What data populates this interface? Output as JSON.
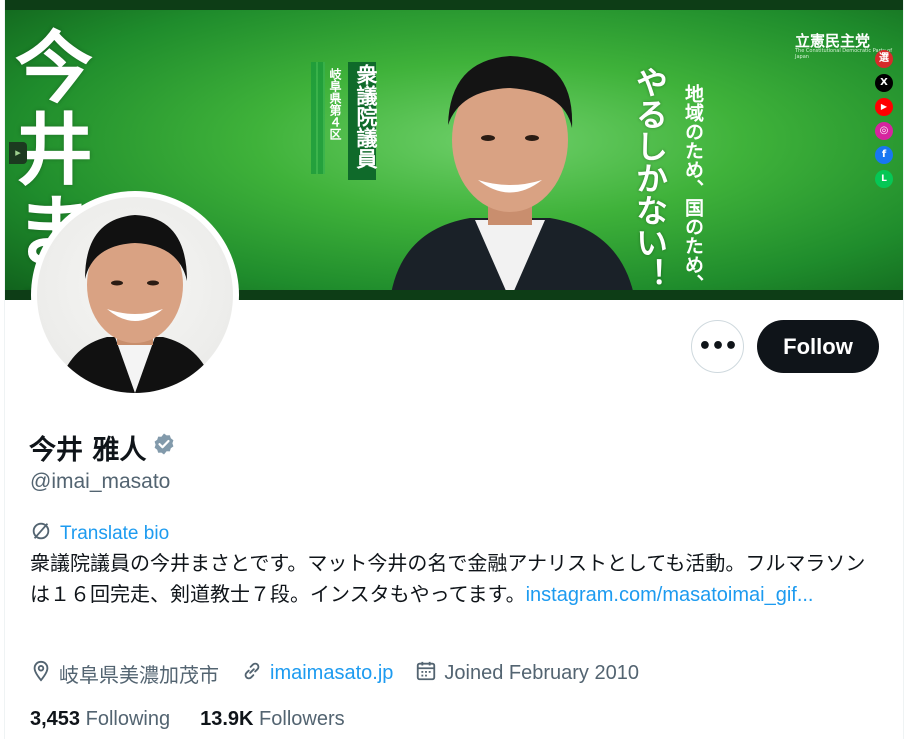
{
  "banner": {
    "big_name": "今井まさ",
    "office_title": "衆議院議員",
    "district": "岐阜県第４区",
    "slogan_big": "やるしかない！",
    "slogan_small": "地域のため、国のため、",
    "party": "立憲民主党",
    "party_sub": "The Constitutional Democratic Party of Japan",
    "social_icons": [
      "senkyo-icon",
      "x-icon",
      "youtube-icon",
      "instagram-icon",
      "facebook-icon",
      "line-icon"
    ],
    "social_glyphs": {
      "senkyo": "選",
      "x": "X",
      "youtube": "▶",
      "instagram": "◎",
      "facebook": "f",
      "line": "L"
    },
    "colors": {
      "green": "#3fb23a",
      "dark_green": "#0d3d16"
    }
  },
  "profile": {
    "display_name": "今井 雅人",
    "handle": "@imai_masato",
    "verified": true,
    "more_label": "•••",
    "follow_label": "Follow"
  },
  "bio": {
    "translate_label": "Translate bio",
    "text": "衆議院議員の今井まさとです。マット今井の名で金融アナリストとしても活動。フルマラソンは１６回完走、剣道教士７段。インスタもやってます。",
    "link_text": "instagram.com/masatoimai_gif..."
  },
  "meta": {
    "location": "岐阜県美濃加茂市",
    "website": "imaimasato.jp",
    "joined": "Joined February 2010"
  },
  "stats": {
    "following_count": "3,453",
    "following_label": "Following",
    "followers_count": "13.9K",
    "followers_label": "Followers"
  },
  "colors": {
    "accent": "#1d9bf0",
    "text": "#0f1419",
    "muted": "#536471",
    "verified": "#829aab"
  }
}
